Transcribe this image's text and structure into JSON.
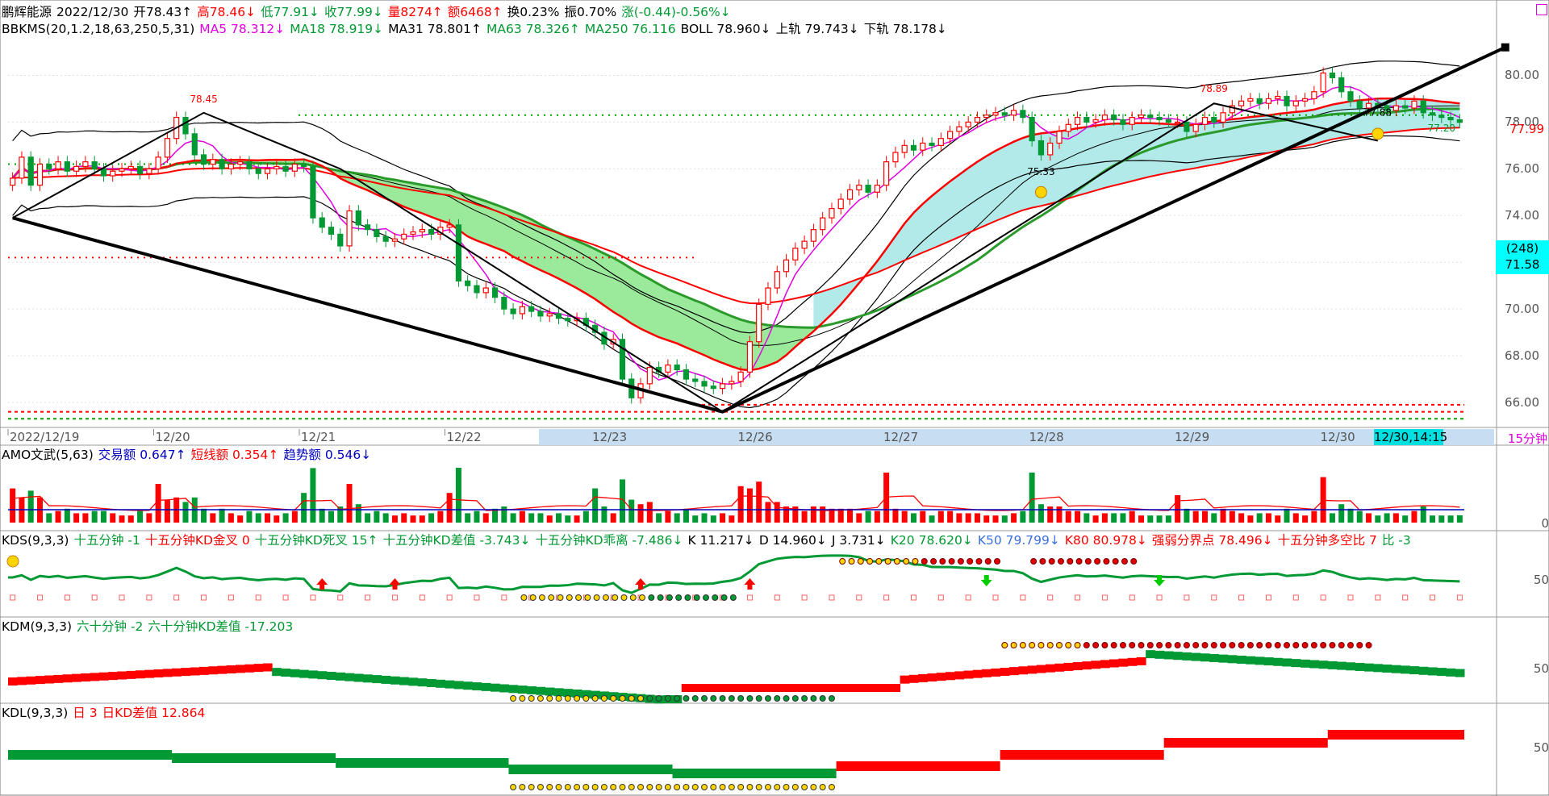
{
  "colors": {
    "up": "#ff0000",
    "down": "#009933",
    "ma5": "#e000e0",
    "ma18": "#009933",
    "ma31": "#000000",
    "boll": "#000000",
    "ma250": "#ff0000",
    "green_fill": "#90e890",
    "cyan_fill": "#aee8e8",
    "yellow": "#ffff66",
    "timebar": "#c6ddf2",
    "highlight": "#00ffff"
  },
  "header": {
    "line1": [
      {
        "text": "鹏辉能源",
        "c": "blk"
      },
      {
        "text": "2022/12/30",
        "c": "blk"
      },
      {
        "text": "开78.43↑",
        "c": "blk"
      },
      {
        "text": "高78.46↓",
        "c": "red"
      },
      {
        "text": "低77.91↓",
        "c": "grn"
      },
      {
        "text": "收77.99↓",
        "c": "grn"
      },
      {
        "text": "量8274↑",
        "c": "red"
      },
      {
        "text": "额6468↑",
        "c": "red"
      },
      {
        "text": "换0.23%",
        "c": "blk"
      },
      {
        "text": "振0.70%",
        "c": "blk"
      },
      {
        "text": "涨(-0.44)-0.56%↓",
        "c": "grn"
      }
    ],
    "line2": [
      {
        "text": "BBKMS(20,1.2,18,63,250,5,31)",
        "c": "blk"
      },
      {
        "text": "MA5 78.312↓",
        "c": "mag"
      },
      {
        "text": "MA18 78.919↓",
        "c": "grn"
      },
      {
        "text": "MA31 78.801↑",
        "c": "blk"
      },
      {
        "text": "MA63 78.326↑",
        "c": "grn"
      },
      {
        "text": "MA250 76.116",
        "c": "grn"
      },
      {
        "text": "BOLL 78.960↓",
        "c": "blk"
      },
      {
        "text": "上轨 79.743↓",
        "c": "blk"
      },
      {
        "text": "下轨 78.178↓",
        "c": "blk"
      }
    ]
  },
  "price_axis": [
    "80.00",
    "78.00",
    "76.00",
    "74.00",
    "72.00",
    "70.00",
    "68.00",
    "66.00"
  ],
  "last_price": "77.99",
  "crosshair_box": {
    "line1": "(248)",
    "line2": "71.58"
  },
  "annotations": [
    "78.45",
    "78.89",
    "77.88",
    "75.33",
    "77.20"
  ],
  "time_axis": [
    "2022/12/19",
    "12/20",
    "12/21",
    "12/22",
    "12/23",
    "12/26",
    "12/27",
    "12/28",
    "12/29",
    "12/30"
  ],
  "time_cursor": "12/30,14:15",
  "period": "15分钟",
  "amo": {
    "header": [
      {
        "text": "AMO文武(5,63)",
        "c": "blk"
      },
      {
        "text": "交易额 0.647↑",
        "c": "blue"
      },
      {
        "text": "短线额 0.354↑",
        "c": "red"
      },
      {
        "text": "趋势额 0.546↓",
        "c": "blue"
      }
    ],
    "axis": "0"
  },
  "kds": {
    "header": [
      {
        "text": "KDS(9,3,3)",
        "c": "blk"
      },
      {
        "text": "十五分钟 -1",
        "c": "grn"
      },
      {
        "text": "十五分钟KD金叉 0",
        "c": "red"
      },
      {
        "text": "十五分钟KD死叉 15↑",
        "c": "grn"
      },
      {
        "text": "十五分钟KD差值 -3.743↓",
        "c": "grn"
      },
      {
        "text": "十五分钟KD乖离 -7.486↓",
        "c": "grn"
      },
      {
        "text": "K 11.217↓",
        "c": "blk"
      },
      {
        "text": "D 14.960↓",
        "c": "blk"
      },
      {
        "text": "J 3.731↓",
        "c": "blk"
      },
      {
        "text": "K20 78.620↓",
        "c": "grn"
      },
      {
        "text": "K50 79.799↓",
        "c": "lblue"
      },
      {
        "text": "K80 80.978↓",
        "c": "red"
      },
      {
        "text": "强弱分界点 78.496↓",
        "c": "red"
      },
      {
        "text": "十五分钟多空比 7",
        "c": "red"
      },
      {
        "text": "比 -3",
        "c": "grn"
      }
    ],
    "axis": "50"
  },
  "kdm": {
    "header": [
      {
        "text": "KDM(9,3,3)",
        "c": "blk"
      },
      {
        "text": "六十分钟 -2",
        "c": "grn"
      },
      {
        "text": "六十分钟KD差值 -17.203",
        "c": "grn"
      }
    ],
    "axis": "50"
  },
  "kdl": {
    "header": [
      {
        "text": "KDL(9,3,3)",
        "c": "blk"
      },
      {
        "text": "日 3",
        "c": "red"
      },
      {
        "text": "日KD差值 12.864",
        "c": "red"
      }
    ],
    "axis": "50"
  },
  "chart_data": {
    "type": "candlestick",
    "title": "鹏辉能源 15分钟",
    "ylim": [
      65,
      81.5
    ],
    "x_ticks": [
      "2022/12/19",
      "12/20",
      "12/21",
      "12/22",
      "12/23",
      "12/26",
      "12/27",
      "12/28",
      "12/29",
      "12/30"
    ],
    "days": [
      {
        "date": "2022/12/19",
        "closes": [
          75.6,
          76.5,
          75.3,
          76.2,
          76.0,
          76.3,
          75.9,
          76.1,
          76.3,
          76.0,
          75.7,
          75.9,
          76.0,
          76.1,
          75.8,
          76.0
        ]
      },
      {
        "date": "12/20",
        "closes": [
          76.5,
          77.3,
          78.2,
          77.5,
          76.6,
          76.2,
          76.4,
          76.0,
          76.2,
          76.3,
          76.0,
          75.8,
          76.0,
          76.1,
          75.9,
          76.2
        ]
      },
      {
        "date": "12/21",
        "closes": [
          76.1,
          73.9,
          73.5,
          73.2,
          72.7,
          74.2,
          73.6,
          73.4,
          73.1,
          72.9,
          73.0,
          73.2,
          73.3,
          73.4,
          73.2,
          73.5
        ]
      },
      {
        "date": "12/22",
        "closes": [
          73.6,
          71.2,
          71.0,
          70.7,
          70.9,
          70.5,
          70.0,
          69.8,
          70.1,
          69.9,
          69.7,
          69.8,
          69.6,
          69.5,
          69.6,
          69.3
        ]
      },
      {
        "date": "12/23",
        "closes": [
          69.0,
          68.5,
          68.7,
          67.0,
          66.2,
          66.8,
          67.5,
          67.3,
          67.6,
          67.4,
          67.0,
          66.9,
          66.7,
          66.6,
          66.8,
          66.9
        ]
      },
      {
        "date": "12/26",
        "closes": [
          67.3,
          68.6,
          70.2,
          70.9,
          71.6,
          72.1,
          72.6,
          72.9,
          73.4,
          73.9,
          74.3,
          74.7,
          75.1,
          75.3,
          75.0,
          75.3
        ]
      },
      {
        "date": "12/27",
        "closes": [
          76.3,
          76.7,
          77.0,
          76.8,
          77.1,
          77.0,
          77.3,
          77.6,
          77.8,
          78.0,
          78.2,
          78.3,
          78.4,
          78.3,
          78.5,
          78.2
        ]
      },
      {
        "date": "12/28",
        "closes": [
          77.2,
          76.6,
          77.1,
          77.6,
          77.9,
          78.2,
          78.0,
          78.1,
          78.3,
          78.1,
          77.9,
          78.2,
          78.3,
          78.2,
          78.1,
          78.0
        ]
      },
      {
        "date": "12/29",
        "closes": [
          78.0,
          77.6,
          77.9,
          78.2,
          78.0,
          78.4,
          78.7,
          78.9,
          79.0,
          78.8,
          79.0,
          79.1,
          78.7,
          78.9,
          79.0,
          79.3
        ]
      },
      {
        "date": "12/30",
        "closes": [
          80.1,
          79.9,
          79.3,
          78.9,
          78.6,
          78.8,
          78.7,
          78.5,
          78.7,
          78.6,
          78.9,
          78.4,
          78.3,
          78.2,
          78.1,
          77.99
        ]
      }
    ],
    "series": [
      {
        "name": "MA5"
      },
      {
        "name": "MA18"
      },
      {
        "name": "MA31"
      },
      {
        "name": "MA250"
      },
      {
        "name": "BOLL"
      }
    ]
  }
}
